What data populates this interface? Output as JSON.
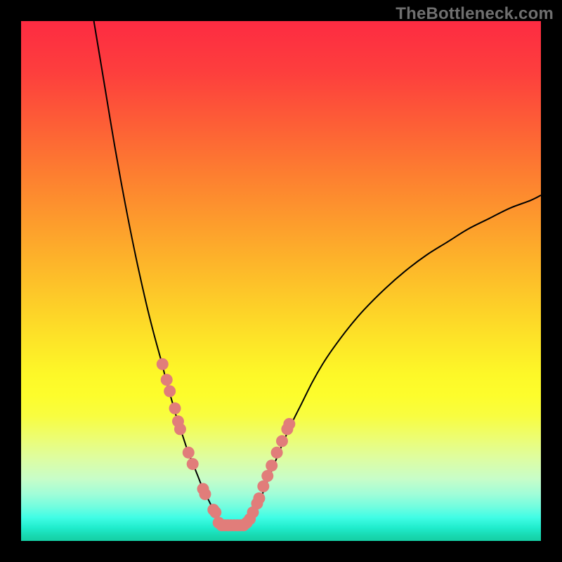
{
  "watermark": "TheBottleneck.com",
  "colors": {
    "background_frame": "#000000",
    "curve": "#000000",
    "marker_fill": "#e17d7a",
    "marker_stroke": "#d86e6c"
  },
  "chart_data": {
    "type": "line",
    "title": "",
    "xlabel": "",
    "ylabel": "",
    "xlim": [
      0,
      100
    ],
    "ylim": [
      0,
      100
    ],
    "grid": false,
    "curve_left": {
      "name": "left-branch",
      "x": [
        14,
        16,
        18,
        20,
        22,
        24,
        25.5,
        27,
        28,
        29,
        30,
        31,
        32,
        33,
        34,
        35,
        36,
        37,
        38,
        38.5,
        39
      ],
      "y": [
        100,
        88,
        76,
        65,
        55,
        46,
        40,
        34.5,
        30.5,
        27,
        23.5,
        20.5,
        17.5,
        15,
        12.5,
        10,
        8,
        6,
        4.5,
        3.5,
        3
      ]
    },
    "curve_right": {
      "name": "right-branch",
      "x": [
        43,
        44,
        45,
        46,
        47,
        48,
        49,
        50,
        52,
        54,
        56,
        58,
        60,
        63,
        66,
        70,
        74,
        78,
        82,
        86,
        90,
        94,
        98,
        100
      ],
      "y": [
        3,
        4,
        6,
        8,
        10.5,
        13,
        15.5,
        18,
        22.5,
        26.5,
        30.5,
        34,
        37,
        41,
        44.5,
        48.5,
        52,
        55,
        57.5,
        60,
        62,
        64,
        65.5,
        66.5
      ]
    },
    "flat_bottom": {
      "name": "valley-floor",
      "x": [
        39,
        40,
        41,
        42,
        43
      ],
      "y": [
        3,
        3,
        3,
        3,
        3
      ]
    },
    "series": [
      {
        "name": "markers-left",
        "type": "scatter",
        "x": [
          27.2,
          28.0,
          28.6,
          29.6,
          30.2,
          30.6,
          32.2,
          33.0,
          35.0,
          35.4,
          37.0,
          37.4
        ],
        "y": [
          34.0,
          31.0,
          28.8,
          25.5,
          23.0,
          21.5,
          17.0,
          14.8,
          10.0,
          9.0,
          6.0,
          5.5
        ]
      },
      {
        "name": "markers-bottom",
        "type": "scatter",
        "x": [
          38.0,
          38.6,
          39.2,
          39.8,
          40.4,
          41.0,
          41.6,
          42.2,
          42.8,
          43.4
        ],
        "y": [
          3.5,
          3.0,
          3.0,
          3.0,
          3.0,
          3.0,
          3.0,
          3.0,
          3.0,
          3.5
        ]
      },
      {
        "name": "markers-right",
        "type": "scatter",
        "x": [
          44.0,
          44.6,
          45.4,
          45.8,
          46.6,
          47.4,
          48.2,
          49.2,
          50.2,
          51.2,
          51.6
        ],
        "y": [
          4.2,
          5.5,
          7.2,
          8.2,
          10.5,
          12.5,
          14.5,
          17.0,
          19.2,
          21.5,
          22.5
        ]
      }
    ]
  }
}
